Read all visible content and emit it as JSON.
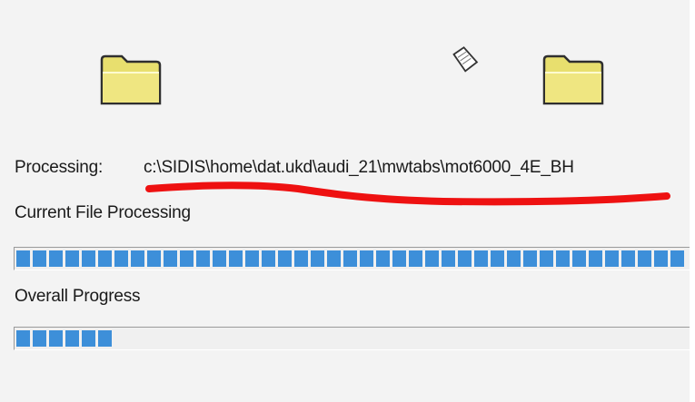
{
  "processing": {
    "label": "Processing:",
    "path": "c:\\SIDIS\\home\\dat.ukd\\audi_21\\mwtabs\\mot6000_4E_BH"
  },
  "current_file": {
    "label": "Current File Processing",
    "progress": 0.99
  },
  "overall": {
    "label": "Overall Progress",
    "progress": 0.145
  },
  "icons": {
    "source_folder": "folder-icon",
    "destination_folder": "folder-icon",
    "flying_document": "document-icon"
  },
  "colors": {
    "progress_fill": "#3d8fd9",
    "annotation_underline": "#ee1111"
  }
}
